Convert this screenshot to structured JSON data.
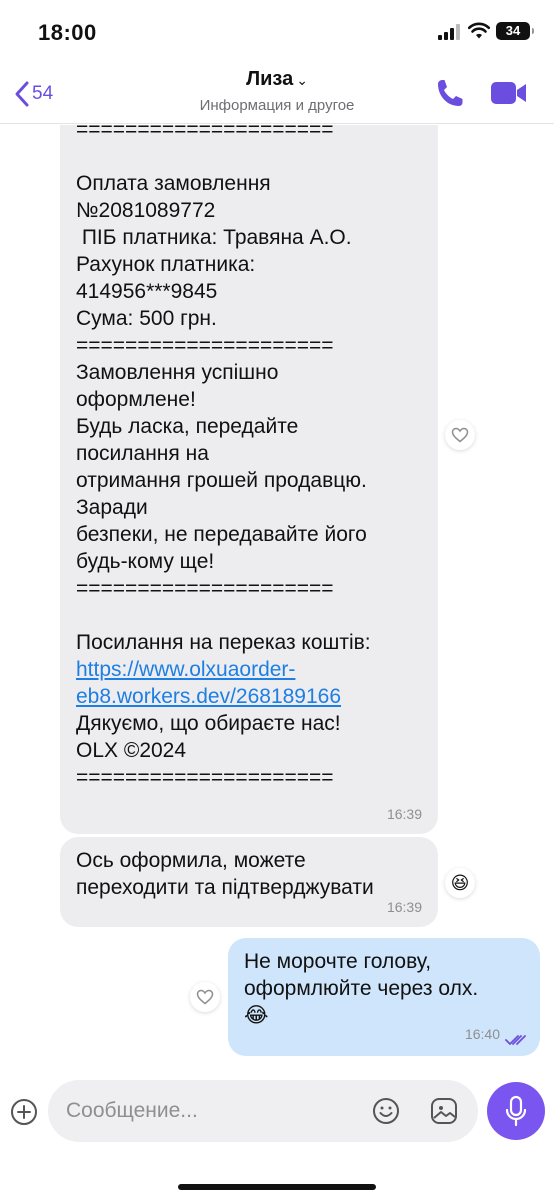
{
  "status_bar": {
    "time": "18:00",
    "battery": "34"
  },
  "header": {
    "back_count": "54",
    "title": "Лиза",
    "title_chevron": "⌄",
    "subtitle": "Информация и другое",
    "call_icon": "phone-icon",
    "video_icon": "video-camera-icon",
    "accent_color": "#6b4ee0"
  },
  "messages": [
    {
      "direction": "incoming",
      "lines": [
        "=====================",
        "",
        "Оплата замовлення",
        "№2081089772",
        " ПІБ платника: Травяна А.О.",
        "Рахунок платника:",
        "414956***9845",
        "Сума: 500 грн.",
        "=====================",
        "Замовлення успішно",
        "оформлене!",
        "Будь ласка, передайте",
        "посилання на",
        "отримання грошей продавцю.",
        "Заради",
        "безпеки, не передавайте його",
        "будь-кому ще!",
        "=====================",
        "",
        "Посилання на переказ коштів:"
      ],
      "link_lines": [
        "https://www.olxuaorder-",
        "eb8.workers.dev/268189166"
      ],
      "after_lines": [
        "Дякуємо, що обираєте нас!",
        "OLX ©2024",
        "====================="
      ],
      "time": "16:39",
      "reaction": "heart-outline-icon"
    },
    {
      "direction": "incoming",
      "lines": [
        "Ось оформила, можете",
        "переходити та підтверджувати"
      ],
      "time": "16:39",
      "reaction": "laughing-emoji",
      "reaction_glyph": "😆"
    },
    {
      "direction": "outgoing",
      "lines": [
        "Не морочте голову,",
        "оформлюйте через олх."
      ],
      "emoji": "😂",
      "time": "16:40",
      "status_icon": "double-check-icon",
      "reaction": "heart-outline-icon"
    }
  ],
  "composer": {
    "placeholder": "Сообщение...",
    "value": "",
    "mic_color": "#7a55f0"
  }
}
